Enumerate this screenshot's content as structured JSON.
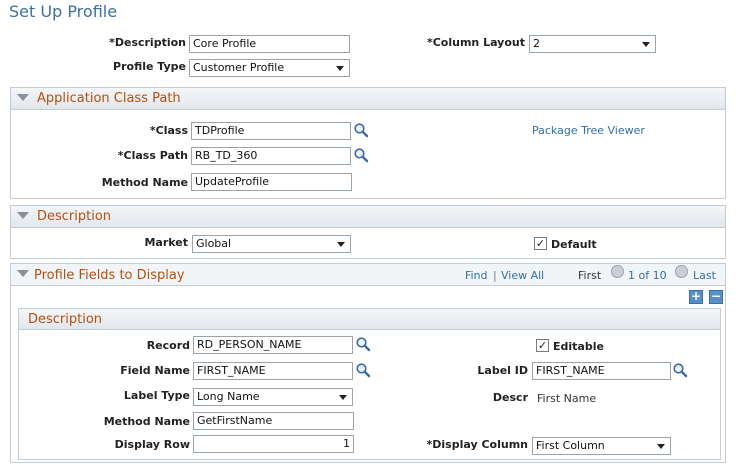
{
  "page": {
    "title": "Set Up Profile"
  },
  "top": {
    "description_label": "*Description",
    "description_value": "Core Profile",
    "column_layout_label": "*Column Layout",
    "column_layout_value": "2",
    "profile_type_label": "Profile Type",
    "profile_type_value": "Customer Profile"
  },
  "app_class": {
    "title": "Application Class Path",
    "class_label": "*Class",
    "class_value": "TDProfile",
    "class_path_label": "*Class Path",
    "class_path_value": "RB_TD_360",
    "method_name_label": "Method Name",
    "method_name_value": "UpdateProfile",
    "package_tree_link": "Package Tree Viewer"
  },
  "description_section": {
    "title": "Description",
    "market_label": "Market",
    "market_value": "Global",
    "default_label": "Default",
    "default_checked": true
  },
  "profile_fields": {
    "title": "Profile Fields to Display",
    "find_link": "Find",
    "separator": "|",
    "view_all_link": "View All",
    "first_label": "First",
    "range_text": "1 of 10",
    "last_label": "Last",
    "add_symbol": "+",
    "remove_symbol": "−",
    "inner": {
      "title": "Description",
      "record_label": "Record",
      "record_value": "RD_PERSON_NAME",
      "editable_label": "Editable",
      "editable_checked": true,
      "field_name_label": "Field Name",
      "field_name_value": "FIRST_NAME",
      "label_id_label": "Label ID",
      "label_id_value": "FIRST_NAME",
      "label_type_label": "Label Type",
      "label_type_value": "Long Name",
      "descr_label": "Descr",
      "descr_value": "First Name",
      "method_name_label": "Method Name",
      "method_name_value": "GetFirstName",
      "display_row_label": "Display Row",
      "display_row_value": "1",
      "display_column_label": "*Display Column",
      "display_column_value": "First Column"
    }
  },
  "icons": {
    "lookup": "magnifier-lookup-icon",
    "prev": "previous-arrow-icon",
    "next": "next-arrow-icon",
    "collapse": "collapse-triangle-icon",
    "check": "check-icon"
  },
  "colors": {
    "title": "#3e6f9f",
    "section_title": "#b3500f",
    "link": "#336ea8"
  }
}
